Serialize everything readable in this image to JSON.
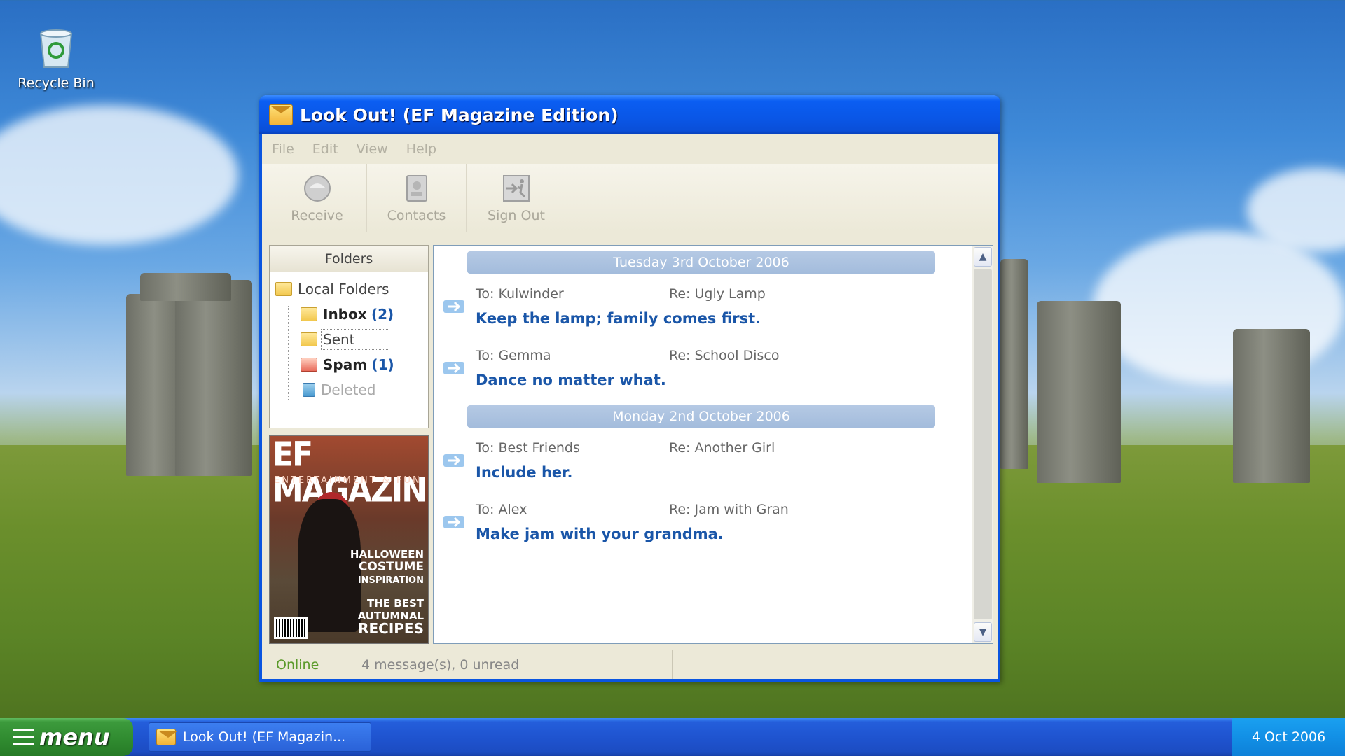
{
  "desktop": {
    "icons": [
      {
        "label": "Recycle Bin",
        "icon": "recycle-bin-icon"
      }
    ]
  },
  "window": {
    "title": "Look Out! (EF Magazine Edition)",
    "menu": [
      "File",
      "Edit",
      "View",
      "Help"
    ],
    "toolbar": [
      {
        "label": "Receive",
        "icon": "receive-icon"
      },
      {
        "label": "Contacts",
        "icon": "contacts-icon"
      },
      {
        "label": "Sign Out",
        "icon": "sign-out-icon"
      }
    ],
    "folders": {
      "header": "Folders",
      "root": "Local Folders",
      "items": [
        {
          "name": "Inbox",
          "count": "(2)"
        },
        {
          "name": "Sent",
          "count": ""
        },
        {
          "name": "Spam",
          "count": "(1)"
        },
        {
          "name": "Deleted",
          "count": ""
        }
      ]
    },
    "magazine": {
      "title": "EF MAGAZINE",
      "subtitle": "ENTERTAINMENT & FUN",
      "line1": "HALLOWEEN",
      "line2": "COSTUME",
      "line3": "INSPIRATION",
      "line4": "THE BEST",
      "line5": "AUTUMNAL",
      "line6": "RECIPES"
    },
    "groups": [
      {
        "date": "Tuesday 3rd October 2006",
        "messages": [
          {
            "to": "To: Kulwinder",
            "re": "Re: Ugly Lamp",
            "body": "Keep the lamp; family comes first."
          },
          {
            "to": "To: Gemma",
            "re": "Re: School Disco",
            "body": "Dance no matter what."
          }
        ]
      },
      {
        "date": "Monday 2nd October 2006",
        "messages": [
          {
            "to": "To: Best Friends",
            "re": "Re: Another Girl",
            "body": "Include her."
          },
          {
            "to": "To: Alex",
            "re": "Re: Jam with Gran",
            "body": "Make jam with your grandma."
          }
        ]
      }
    ],
    "status": {
      "connection": "Online",
      "summary": "4 message(s), 0 unread"
    }
  },
  "taskbar": {
    "start_label": "menu",
    "task_label": "Look Out! (EF Magazin...",
    "clock": "4 Oct 2006"
  },
  "colors": {
    "accent": "#0a55e0",
    "link": "#1a56a8",
    "online": "#5a9a2a"
  }
}
